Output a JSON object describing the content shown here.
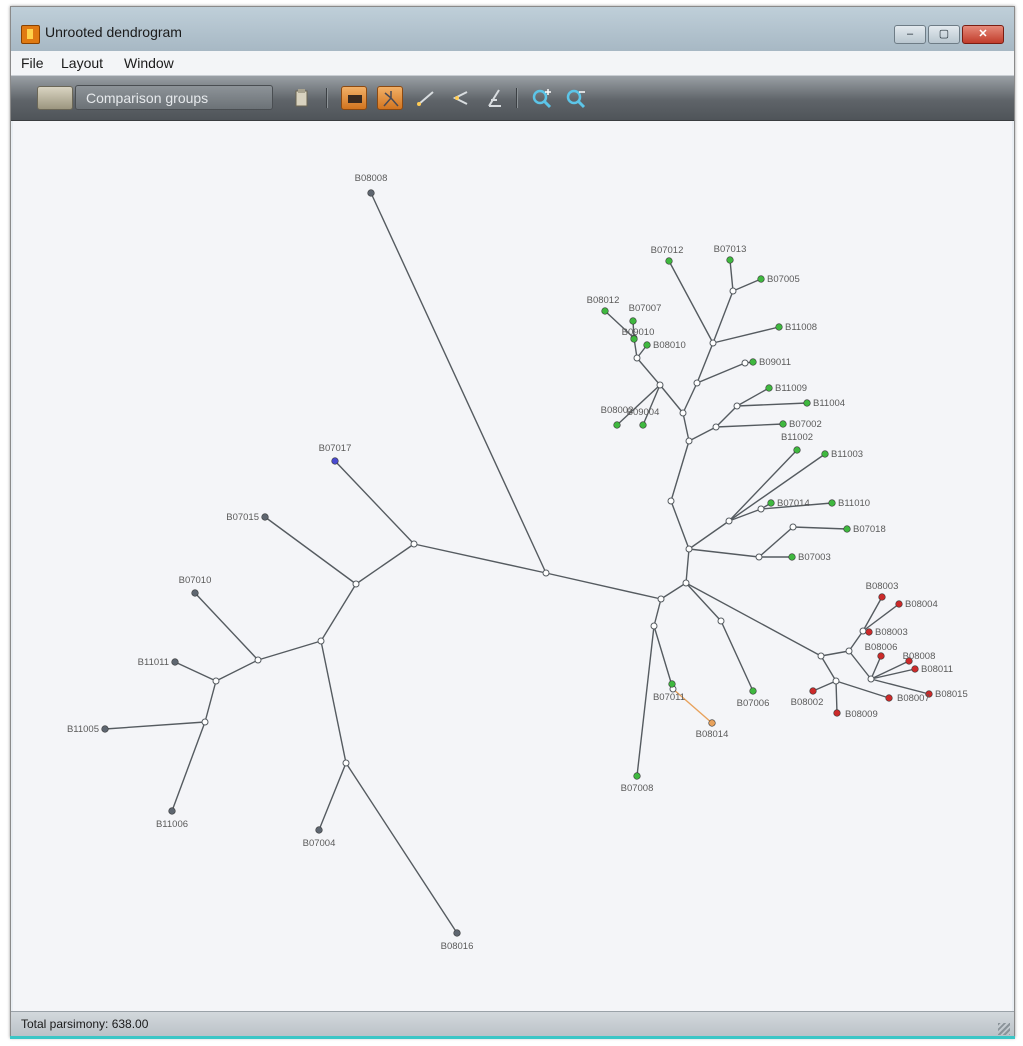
{
  "window": {
    "title": "Unrooted dendrogram",
    "minimize_label": "–",
    "maximize_label": "▢",
    "close_label": "✕"
  },
  "menu": {
    "items": [
      "File",
      "Layout",
      "Window"
    ]
  },
  "toolbar": {
    "open_icon": "folder-icon",
    "groups_combo_value": "Comparison groups",
    "buttons": [
      {
        "name": "copy-button",
        "icon": "clipboard-icon",
        "active": false
      },
      {
        "name": "layout-radial-button",
        "icon": "box-icon",
        "active": true
      },
      {
        "name": "layout-tree-button",
        "icon": "tree-icon",
        "active": true
      },
      {
        "name": "branch-length-button",
        "icon": "line-icon",
        "active": false
      },
      {
        "name": "flip-button",
        "icon": "arrow-icon",
        "active": false
      },
      {
        "name": "rotate-button",
        "icon": "angle-icon",
        "active": false
      },
      {
        "name": "zoom-in-button",
        "icon": "zoom-in-icon",
        "active": false
      },
      {
        "name": "zoom-out-button",
        "icon": "zoom-out-icon",
        "active": false
      }
    ]
  },
  "colors": {
    "green": "#3fb83f",
    "red": "#cc2a2a",
    "blue": "#4a4ad0",
    "grey": "#5e6670",
    "orange": "#e8a25c",
    "edge": "#555b60",
    "canvas": "#f4f5f8"
  },
  "status": {
    "text": "Total parsimony: 638.00"
  },
  "leaves": [
    {
      "id": "B08008",
      "color": "grey"
    },
    {
      "id": "B07017",
      "color": "blue"
    },
    {
      "id": "B07015",
      "color": "grey"
    },
    {
      "id": "B07010",
      "color": "grey"
    },
    {
      "id": "B11011",
      "color": "grey"
    },
    {
      "id": "B11005",
      "color": "grey"
    },
    {
      "id": "B11006",
      "color": "grey"
    },
    {
      "id": "B07004",
      "color": "grey"
    },
    {
      "id": "B08016",
      "color": "grey"
    },
    {
      "id": "B07012",
      "color": "green"
    },
    {
      "id": "B07013",
      "color": "green"
    },
    {
      "id": "B07005",
      "color": "green"
    },
    {
      "id": "B08012",
      "color": "green"
    },
    {
      "id": "B07007",
      "color": "green"
    },
    {
      "id": "B09010",
      "color": "green"
    },
    {
      "id": "B08010",
      "color": "green"
    },
    {
      "id": "B11008",
      "color": "green"
    },
    {
      "id": "B09011",
      "color": "green"
    },
    {
      "id": "B11009",
      "color": "green"
    },
    {
      "id": "B11004",
      "color": "green"
    },
    {
      "id": "B08002",
      "color": "green"
    },
    {
      "id": "B09004",
      "color": "green"
    },
    {
      "id": "B07002",
      "color": "green"
    },
    {
      "id": "B11002",
      "color": "green"
    },
    {
      "id": "B11003",
      "color": "green"
    },
    {
      "id": "B07014",
      "color": "green"
    },
    {
      "id": "B11010",
      "color": "green"
    },
    {
      "id": "B07018",
      "color": "green"
    },
    {
      "id": "B07003",
      "color": "green"
    },
    {
      "id": "B08003",
      "color": "red"
    },
    {
      "id": "B08004",
      "color": "red"
    },
    {
      "id": "B08003",
      "color": "red"
    },
    {
      "id": "B08006",
      "color": "red"
    },
    {
      "id": "B08008",
      "color": "red"
    },
    {
      "id": "B08011",
      "color": "red"
    },
    {
      "id": "B08015",
      "color": "red"
    },
    {
      "id": "B08007",
      "color": "red"
    },
    {
      "id": "B08002",
      "color": "red"
    },
    {
      "id": "B08009",
      "color": "red"
    },
    {
      "id": "B07006",
      "color": "green"
    },
    {
      "id": "B07011",
      "color": "green"
    },
    {
      "id": "B08014",
      "color": "orange"
    },
    {
      "id": "B07008",
      "color": "green"
    }
  ]
}
